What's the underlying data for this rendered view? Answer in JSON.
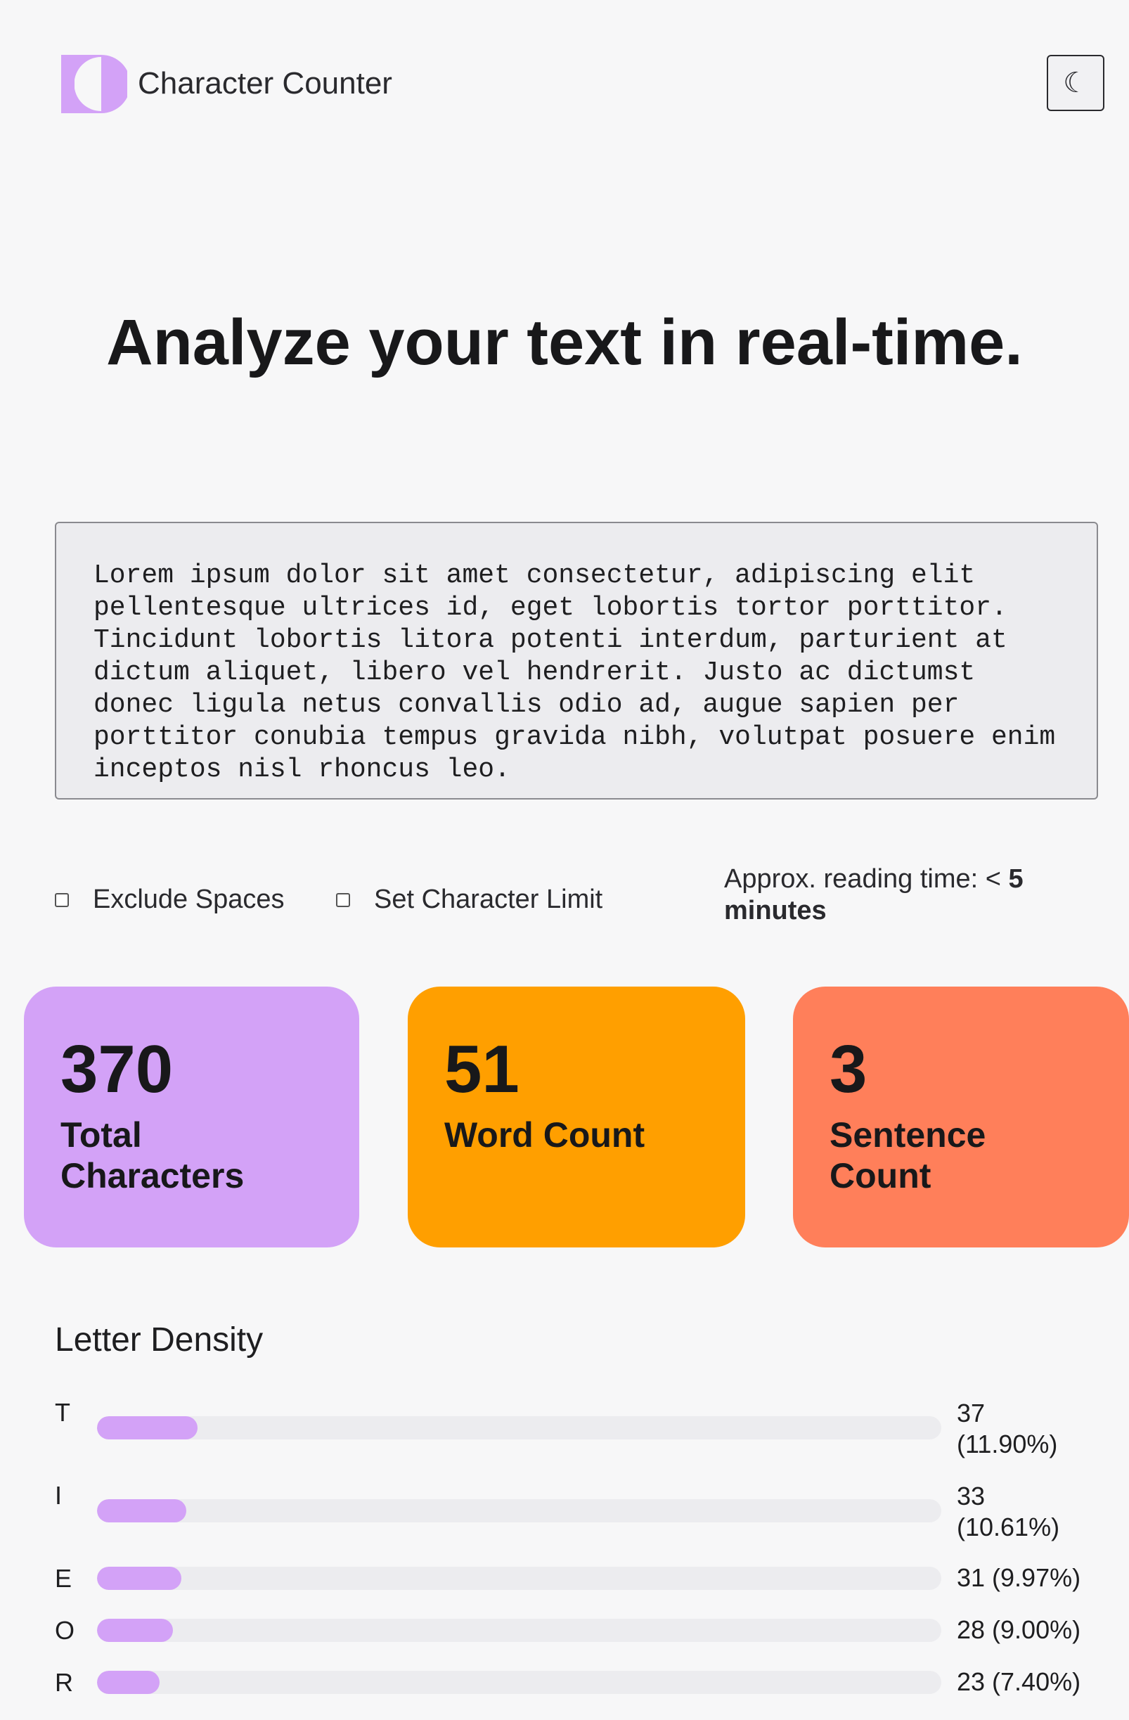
{
  "header": {
    "title": "Character Counter",
    "logo_color": "#d3a2f7",
    "theme_toggle_icon": "moon-icon",
    "theme_toggle_glyph": "☾"
  },
  "hero": {
    "title": "Analyze your text in real-time."
  },
  "text_input": {
    "value": "Lorem ipsum dolor sit amet consectetur, adipiscing elit pellentesque ultrices id, eget lobortis tortor porttitor. Tincidunt lobortis litora potenti interdum, parturient at dictum aliquet, libero vel hendrerit. Justo ac dictumst donec ligula netus convallis odio ad, augue sapien per porttitor conubia tempus gravida nibh, volutpat posuere enim inceptos nisl rhoncus leo."
  },
  "options": {
    "exclude_spaces": {
      "label": "Exclude Spaces",
      "checked": false
    },
    "char_limit": {
      "label": "Set Character Limit",
      "checked": false
    },
    "reading_time": {
      "prefix": "Approx. reading time: < ",
      "value": "5 minutes"
    }
  },
  "stats": [
    {
      "value": "370",
      "label": "Total Characters",
      "color": "#d3a2f7"
    },
    {
      "value": "51",
      "label": "Word Count",
      "color": "#ff9f00"
    },
    {
      "value": "3",
      "label": "Sentence Count",
      "color": "#ff7f5a"
    }
  ],
  "letter_density": {
    "title": "Letter Density",
    "rows": [
      {
        "letter": "T",
        "count_label": "37 (11.90%)",
        "percent": 11.9
      },
      {
        "letter": "I",
        "count_label": "33 (10.61%)",
        "percent": 10.61
      },
      {
        "letter": "E",
        "count_label": "31 (9.97%)",
        "percent": 9.97
      },
      {
        "letter": "O",
        "count_label": "28 (9.00%)",
        "percent": 9.0
      },
      {
        "letter": "R",
        "count_label": "23 (7.40%)",
        "percent": 7.4
      }
    ]
  }
}
